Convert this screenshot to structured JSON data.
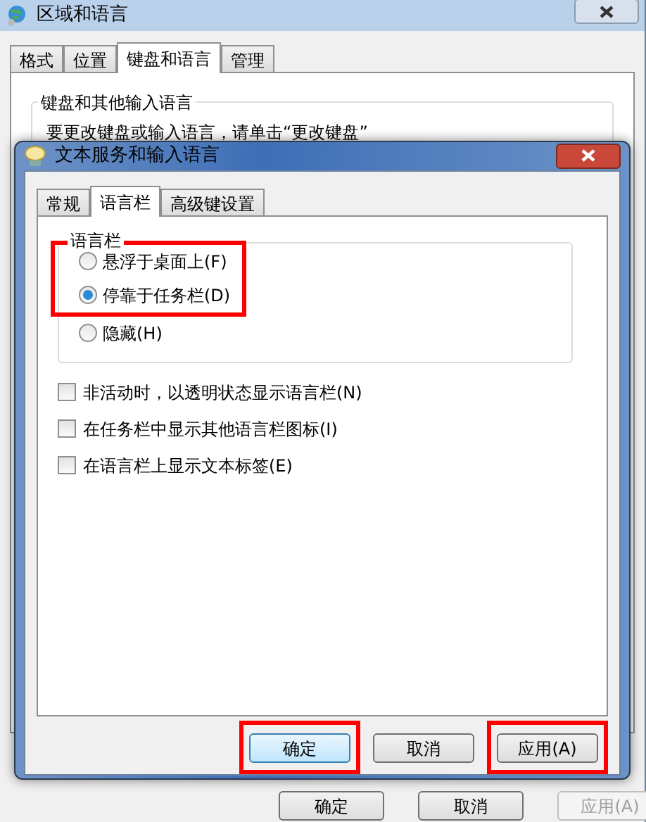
{
  "back_window": {
    "title": "区域和语言",
    "tabs": [
      {
        "label": "格式",
        "selected": false
      },
      {
        "label": "位置",
        "selected": false
      },
      {
        "label": "键盘和语言",
        "selected": true
      },
      {
        "label": "管理",
        "selected": false
      }
    ],
    "group_title": "键盘和其他输入语言",
    "group_text": "要更改键盘或输入语言，请单击“更改键盘”",
    "buttons": [
      {
        "label": "确定",
        "disabled": false
      },
      {
        "label": "取消",
        "disabled": false
      },
      {
        "label": "应用(A)",
        "disabled": true
      }
    ]
  },
  "dialog": {
    "title": "文本服务和输入语言",
    "tabs": [
      {
        "label": "常规",
        "selected": false
      },
      {
        "label": "语言栏",
        "selected": true
      },
      {
        "label": "高级键设置",
        "selected": false
      }
    ],
    "language_bar": {
      "label": "语言栏",
      "options": [
        {
          "label": "悬浮于桌面上(F)",
          "selected": false,
          "highlighted": true
        },
        {
          "label": "停靠于任务栏(D)",
          "selected": true,
          "highlighted": true
        },
        {
          "label": "隐藏(H)",
          "selected": false,
          "highlighted": false
        }
      ]
    },
    "checkboxes": [
      {
        "label": "非活动时，以透明状态显示语言栏(N)",
        "checked": false
      },
      {
        "label": "在任务栏中显示其他语言栏图标(I)",
        "checked": false
      },
      {
        "label": "在语言栏上显示文本标签(E)",
        "checked": false
      }
    ],
    "buttons": [
      {
        "label": "确定",
        "highlighted": true,
        "default": true
      },
      {
        "label": "取消",
        "highlighted": false,
        "default": false
      },
      {
        "label": "应用(A)",
        "highlighted": true,
        "default": false
      }
    ]
  }
}
